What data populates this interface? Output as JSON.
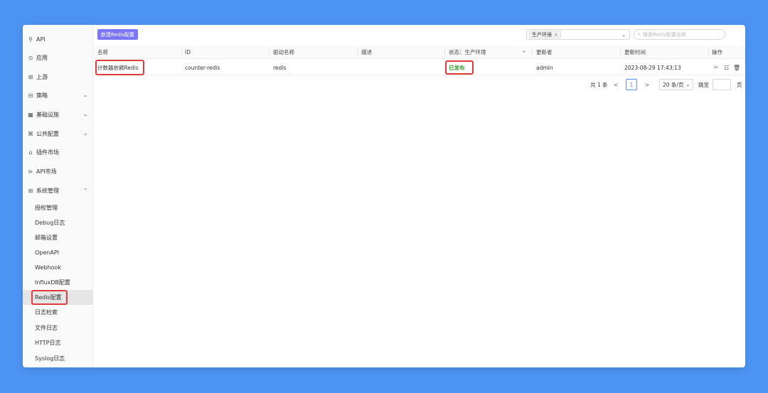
{
  "sidebar": {
    "items": [
      {
        "icon": "link-icon",
        "icon_glyph": "⚲",
        "label": "API"
      },
      {
        "icon": "app-icon",
        "icon_glyph": "⊙",
        "label": "应用"
      },
      {
        "icon": "upstream-icon",
        "icon_glyph": "⊞",
        "label": "上游"
      },
      {
        "icon": "strategy-icon",
        "icon_glyph": "⊟",
        "label": "策略",
        "chevron": "⌄"
      },
      {
        "icon": "infra-icon",
        "icon_glyph": "▦",
        "label": "基础设施",
        "chevron": "⌄"
      },
      {
        "icon": "public-config-icon",
        "icon_glyph": "⌘",
        "label": "公共配置",
        "chevron": "⌄"
      },
      {
        "icon": "plugin-market-icon",
        "icon_glyph": "⌂",
        "label": "插件市场"
      },
      {
        "icon": "api-market-icon",
        "icon_glyph": "⊳",
        "label": "API市场"
      },
      {
        "icon": "system-icon",
        "icon_glyph": "⊞",
        "label": "系统管理",
        "chevron": "⌃"
      }
    ],
    "sub_items": [
      "授权管理",
      "Debug日志",
      "邮箱设置",
      "OpenAPI",
      "Webhook",
      "InfluxDB配置",
      "Redis配置",
      "日志检索",
      "文件日志",
      "HTTP日志",
      "Syslog日志"
    ],
    "active_sub": "Redis配置"
  },
  "toolbar": {
    "new_button": "新建Redis配置",
    "env_tag": "生产环境",
    "tag_close": "×",
    "select_arrow": "⌄",
    "search_icon": "⌕",
    "search_placeholder": "搜索Redis配置名称"
  },
  "table": {
    "headers": {
      "name": "名称",
      "id": "ID",
      "driver": "驱动名称",
      "desc": "描述",
      "status": "状态：生产环境",
      "filter_icon": "⏷",
      "updater": "更新者",
      "updated_at": "更新时间",
      "ops": "操作"
    },
    "rows": [
      {
        "name": "计数器依赖Redis",
        "id": "counter-redis",
        "driver": "redis",
        "desc": "",
        "status": "已发布",
        "updater": "admin",
        "updated_at": "2023-08-29 17:43:13"
      }
    ],
    "actions": {
      "publish": "⌲",
      "edit": "☷",
      "delete": "🗑"
    }
  },
  "pagination": {
    "total": "共 1 条",
    "prev": "<",
    "current": "1",
    "next": ">",
    "page_size": "20 条/页",
    "size_arrow": "⌄",
    "jump_label": "跳至",
    "page_unit": "页"
  },
  "colors": {
    "primary": "#7b76f5",
    "highlight": "#e03b3b",
    "status_published": "#2f9b2f",
    "background": "#4d94f2"
  }
}
